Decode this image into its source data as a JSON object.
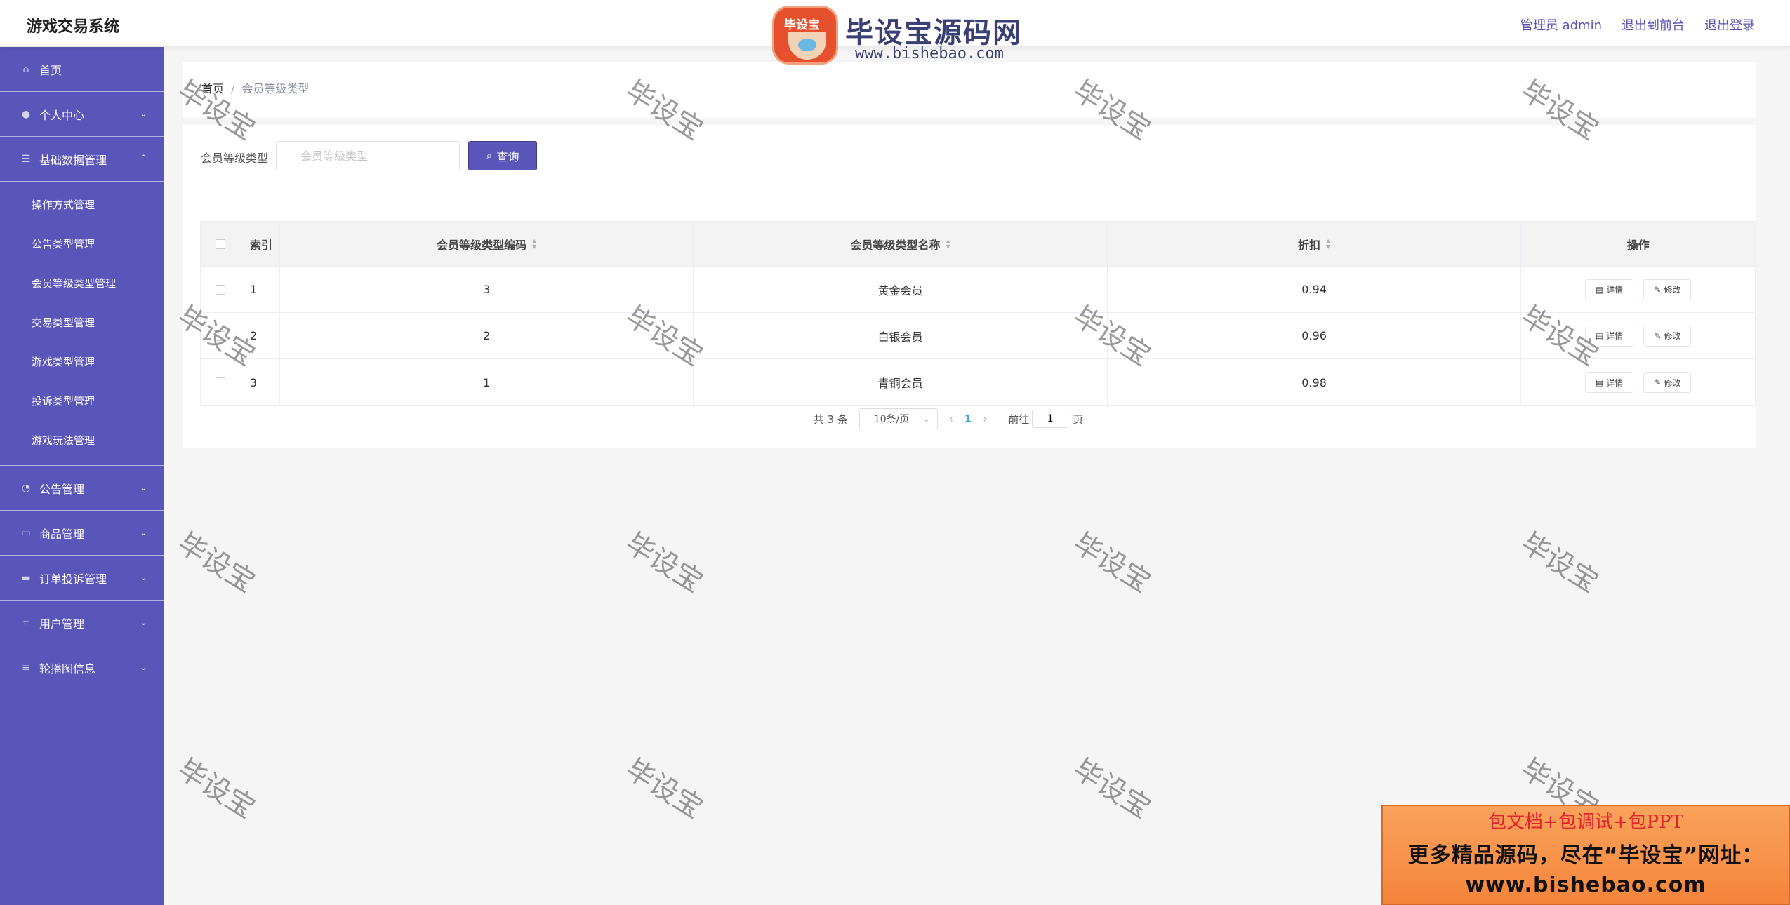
{
  "header": {
    "title": "游戏交易系统",
    "admin_label": "管理员 admin",
    "front_label": "退出到前台",
    "logout_label": "退出登录"
  },
  "sidebar": {
    "items": [
      {
        "label": "首页",
        "icon": "home-icon"
      },
      {
        "label": "个人中心",
        "icon": "user-icon"
      },
      {
        "label": "基础数据管理",
        "icon": "list-icon"
      },
      {
        "label": "公告管理",
        "icon": "dashboard-icon"
      },
      {
        "label": "商品管理",
        "icon": "chat-icon"
      },
      {
        "label": "订单投诉管理",
        "icon": "monitor-icon"
      },
      {
        "label": "用户管理",
        "icon": "crop-icon"
      },
      {
        "label": "轮播图信息",
        "icon": "stack-icon"
      }
    ],
    "submenu": [
      "操作方式管理",
      "公告类型管理",
      "会员等级类型管理",
      "交易类型管理",
      "游戏类型管理",
      "投诉类型管理",
      "游戏玩法管理"
    ]
  },
  "breadcrumb": {
    "home": "首页",
    "separator": "/",
    "current": "会员等级类型"
  },
  "search": {
    "label": "会员等级类型",
    "placeholder": "会员等级类型",
    "value": "",
    "button": "查询"
  },
  "table": {
    "headers": {
      "index": "索引",
      "code": "会员等级类型编码",
      "name": "会员等级类型名称",
      "discount": "折扣",
      "ops": "操作"
    },
    "rows": [
      {
        "index": "1",
        "code": "3",
        "name": "黄金会员",
        "discount": "0.94"
      },
      {
        "index": "2",
        "code": "2",
        "name": "白银会员",
        "discount": "0.96"
      },
      {
        "index": "3",
        "code": "1",
        "name": "青铜会员",
        "discount": "0.98"
      }
    ],
    "detail_label": "详情",
    "edit_label": "修改"
  },
  "pagination": {
    "total": "共 3 条",
    "page_size": "10条/页",
    "current": "1",
    "goto_label": "前往",
    "goto_value": "1",
    "page_suffix": "页"
  },
  "logo": {
    "badge": "毕设宝",
    "name": "毕设宝源码网",
    "url": "www.bishebao.com"
  },
  "watermark": "毕设宝",
  "ad": {
    "line1": "包文档+包调试+包PPT",
    "line2": "更多精品源码，尽在“毕设宝”网址：",
    "line3": "www.bishebao.com"
  },
  "colors": {
    "accent": "#5a55b8",
    "page_link": "#3aa0d8",
    "ad_red": "#e0242b"
  }
}
